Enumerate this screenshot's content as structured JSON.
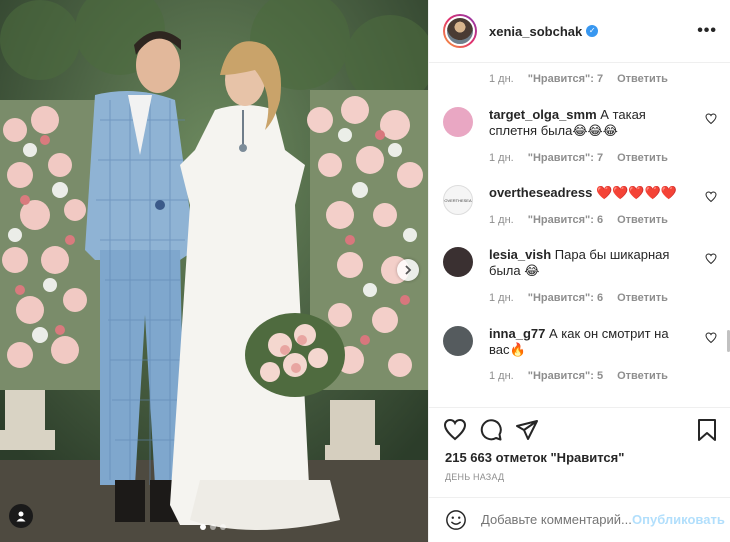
{
  "post": {
    "username": "xenia_sobchak",
    "verified_icon": "verified-badge-icon",
    "more_label": "•••"
  },
  "comments": {
    "first_meta": {
      "time": "1 дн.",
      "likes": "\"Нравится\": 7",
      "reply": "Ответить"
    },
    "items": [
      {
        "username": "target_olga_smm",
        "text": "А такая сплетня была😂😂😂",
        "time": "1 дн.",
        "likes": "\"Нравится\": 7",
        "reply": "Ответить",
        "avatar_color": "#e9a7c3"
      },
      {
        "username": "overtheseadress",
        "text": "❤️❤️❤️❤️❤️",
        "time": "1 дн.",
        "likes": "\"Нравится\": 6",
        "reply": "Ответить",
        "avatar_color": "#f5f5f5"
      },
      {
        "username": "lesia_vish",
        "text": "Пара бы шикарная была 😂",
        "time": "1 дн.",
        "likes": "\"Нравится\": 6",
        "reply": "Ответить",
        "avatar_color": "#3a3031"
      },
      {
        "username": "inna_g77",
        "text": "А как он смотрит на вас🔥",
        "time": "1 дн.",
        "likes": "\"Нравится\": 5",
        "reply": "Ответить",
        "avatar_color": "#555b5e"
      }
    ]
  },
  "actions": {
    "likes": "215 663 отметок \"Нравится\"",
    "date": "ДЕНЬ НАЗАД"
  },
  "add_comment": {
    "placeholder": "Добавьте комментарий...",
    "publish": "Опубликовать"
  },
  "colors": {
    "accent": "#3897f0",
    "publish_disabled": "#b2dffc",
    "like_red": "#ed4956"
  }
}
